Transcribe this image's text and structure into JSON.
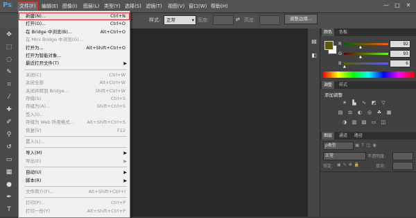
{
  "app": {
    "logo": "Ps"
  },
  "menubar": {
    "items": [
      "文件(F)",
      "编辑(E)",
      "图像(I)",
      "图层(L)",
      "类型(Y)",
      "选择(S)",
      "滤镜(T)",
      "视图(V)",
      "窗口(W)",
      "帮助(H)"
    ]
  },
  "window_controls": {
    "minimize": "—",
    "maximize": "□",
    "close": "✕"
  },
  "optionsbar": {
    "style_label": "样式:",
    "style_value": "正常",
    "width_label": "宽度:",
    "height_label": "高度:",
    "swap": "⇄",
    "adjust_edge_button": "调整边缘..."
  },
  "file_menu": {
    "items": [
      {
        "label": "新建(N)...",
        "shortcut": "Ctrl+N",
        "enabled": true,
        "highlighted": true
      },
      {
        "label": "打开(O)...",
        "shortcut": "Ctrl+O",
        "enabled": true
      },
      {
        "label": "在 Bridge 中浏览(B)...",
        "shortcut": "Alt+Ctrl+O",
        "enabled": true
      },
      {
        "label": "在 Mini Bridge 中浏览(G)...",
        "shortcut": "",
        "enabled": false
      },
      {
        "label": "打开为...",
        "shortcut": "Alt+Shift+Ctrl+O",
        "enabled": true
      },
      {
        "label": "打开为智能对象...",
        "shortcut": "",
        "enabled": true
      },
      {
        "label": "最近打开文件(T)",
        "shortcut": "",
        "enabled": true,
        "submenu": true
      },
      {
        "separator": true
      },
      {
        "label": "关闭(C)",
        "shortcut": "Ctrl+W",
        "enabled": false
      },
      {
        "label": "关闭全部",
        "shortcut": "Alt+Ctrl+W",
        "enabled": false
      },
      {
        "label": "关闭并转到 Bridge...",
        "shortcut": "Shift+Ctrl+W",
        "enabled": false
      },
      {
        "label": "存储(S)",
        "shortcut": "Ctrl+S",
        "enabled": false
      },
      {
        "label": "存储为(A)...",
        "shortcut": "Shift+Ctrl+S",
        "enabled": false
      },
      {
        "label": "签入(I)...",
        "shortcut": "",
        "enabled": false
      },
      {
        "label": "存储为 Web 所用格式...",
        "shortcut": "Alt+Shift+Ctrl+S",
        "enabled": false
      },
      {
        "label": "恢复(V)",
        "shortcut": "F12",
        "enabled": false
      },
      {
        "separator": true
      },
      {
        "label": "置入(L)...",
        "shortcut": "",
        "enabled": false
      },
      {
        "separator": true
      },
      {
        "label": "导入(M)",
        "shortcut": "",
        "enabled": true,
        "submenu": true
      },
      {
        "label": "导出(E)",
        "shortcut": "",
        "enabled": false,
        "submenu": true
      },
      {
        "separator": true
      },
      {
        "label": "自动(U)",
        "shortcut": "",
        "enabled": true,
        "submenu": true
      },
      {
        "label": "脚本(R)",
        "shortcut": "",
        "enabled": true,
        "submenu": true
      },
      {
        "separator": true
      },
      {
        "label": "文件简介(F)...",
        "shortcut": "Alt+Shift+Ctrl+I",
        "enabled": false
      },
      {
        "separator": true
      },
      {
        "label": "打印(P)...",
        "shortcut": "Ctrl+P",
        "enabled": false
      },
      {
        "label": "打印一份(Y)",
        "shortcut": "Alt+Shift+Ctrl+P",
        "enabled": false
      }
    ]
  },
  "color_panel": {
    "tabs": [
      "颜色",
      "色板"
    ],
    "r_label": "R",
    "r_value": "92",
    "g_label": "G",
    "g_value": "93",
    "b_label": "B",
    "b_value": "6",
    "foreground_color": "#5c5d06",
    "background_color": "#ffffff"
  },
  "adjustments_panel": {
    "tabs": [
      "调整",
      "样式"
    ],
    "title": "添加调整"
  },
  "layers_panel": {
    "tabs": [
      "图层",
      "通道",
      "路径"
    ],
    "kind_label": "ρ类型",
    "blend_mode": "正常",
    "opacity_label": "不透明度:",
    "lock_label": "锁定:",
    "fill_label": "填充:"
  }
}
